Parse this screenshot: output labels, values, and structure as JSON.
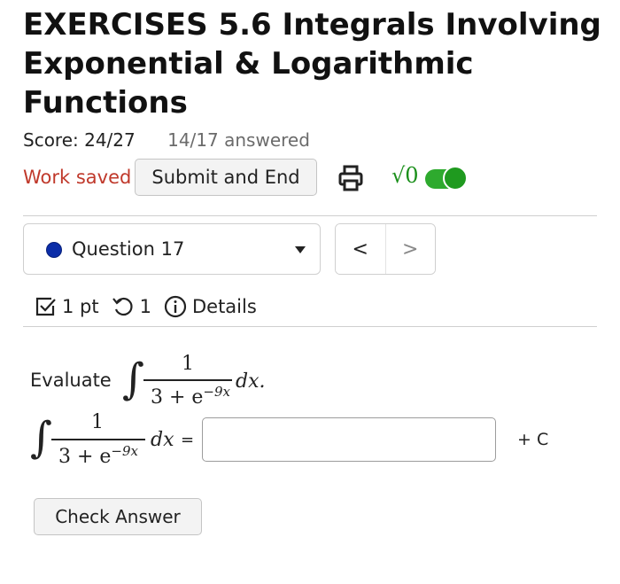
{
  "header": {
    "title": "EXERCISES 5.6 Integrals Involving Exponential & Logarithmic Functions",
    "score": "Score: 24/27",
    "answered": "14/17 answered",
    "work_status": "Work saved",
    "submit_label": "Submit and End",
    "print_icon": "printer-icon",
    "math_toggle_label": "√0",
    "math_toggle_on": true,
    "accent_color": "#2eaa2e",
    "saved_color": "#c0392b"
  },
  "question_nav": {
    "selected": "Question 17",
    "status_color": "#0b2da8",
    "prev_label": "<",
    "next_label": ">"
  },
  "meta": {
    "points": "1 pt",
    "attempts": "1",
    "details_label": "Details"
  },
  "problem": {
    "prompt": "Evaluate",
    "numerator": "1",
    "denominator_base": "3 + e",
    "exponent": "−9x",
    "differential": "dx.",
    "differential_answer": "dx",
    "equals": "=",
    "answer_value": "",
    "constant": "+ C"
  },
  "actions": {
    "check_label": "Check Answer"
  }
}
